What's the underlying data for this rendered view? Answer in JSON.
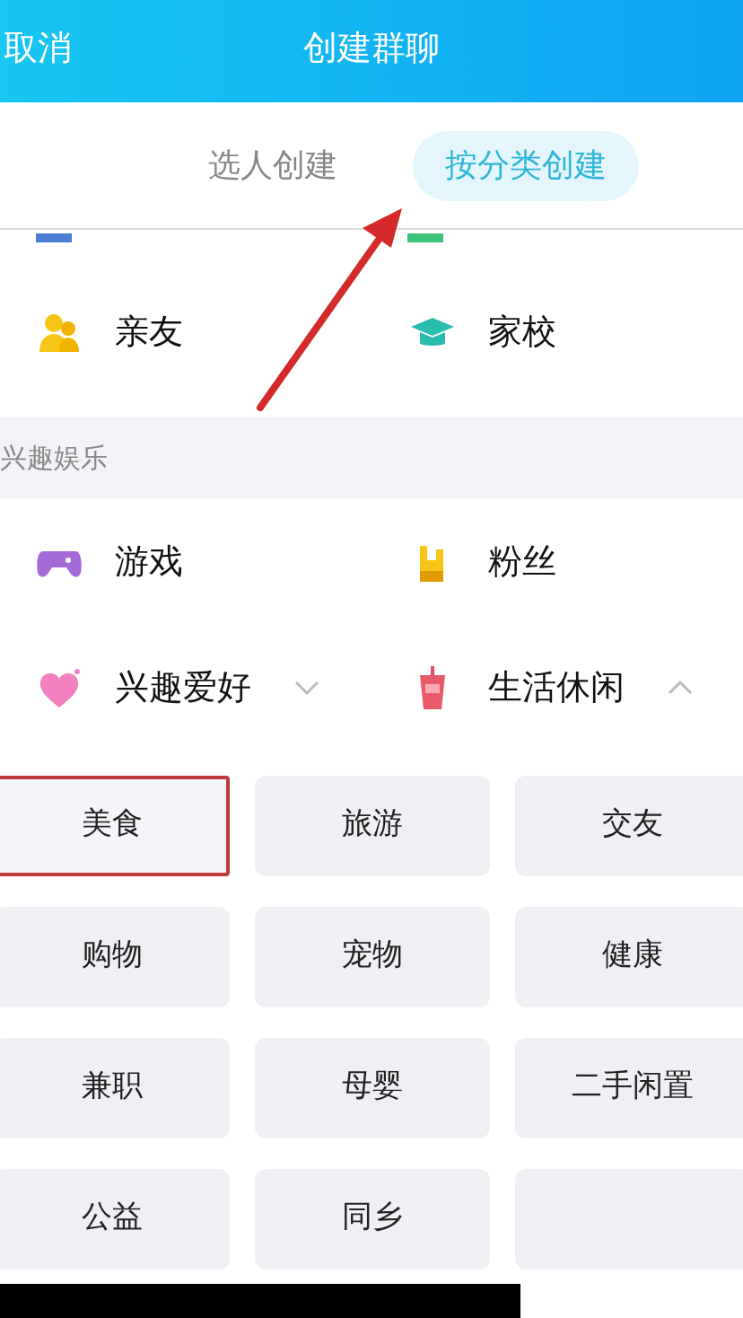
{
  "header": {
    "cancel": "取消",
    "title": "创建群聊"
  },
  "tabs": [
    {
      "label": "选人创建",
      "selected": false
    },
    {
      "label": "按分类创建",
      "selected": true
    }
  ],
  "top_categories": [
    {
      "label": "亲友",
      "kind": "people"
    },
    {
      "label": "家校",
      "kind": "cap"
    }
  ],
  "section": {
    "title": "兴趣娱乐",
    "items": [
      {
        "label": "游戏",
        "kind": "gamepad"
      },
      {
        "label": "粉丝",
        "kind": "hand"
      },
      {
        "label": "兴趣爱好",
        "kind": "heart",
        "expanded": false
      },
      {
        "label": "生活休闲",
        "kind": "cup",
        "expanded": true
      }
    ]
  },
  "subcategories": [
    {
      "label": "美食",
      "selected": true
    },
    {
      "label": "旅游",
      "selected": false
    },
    {
      "label": "交友",
      "selected": false
    },
    {
      "label": "购物",
      "selected": false
    },
    {
      "label": "宠物",
      "selected": false
    },
    {
      "label": "健康",
      "selected": false
    },
    {
      "label": "兼职",
      "selected": false
    },
    {
      "label": "母婴",
      "selected": false
    },
    {
      "label": "二手闲置",
      "selected": false
    },
    {
      "label": "公益",
      "selected": false
    },
    {
      "label": "同乡",
      "selected": false
    },
    {
      "selected": false
    }
  ]
}
